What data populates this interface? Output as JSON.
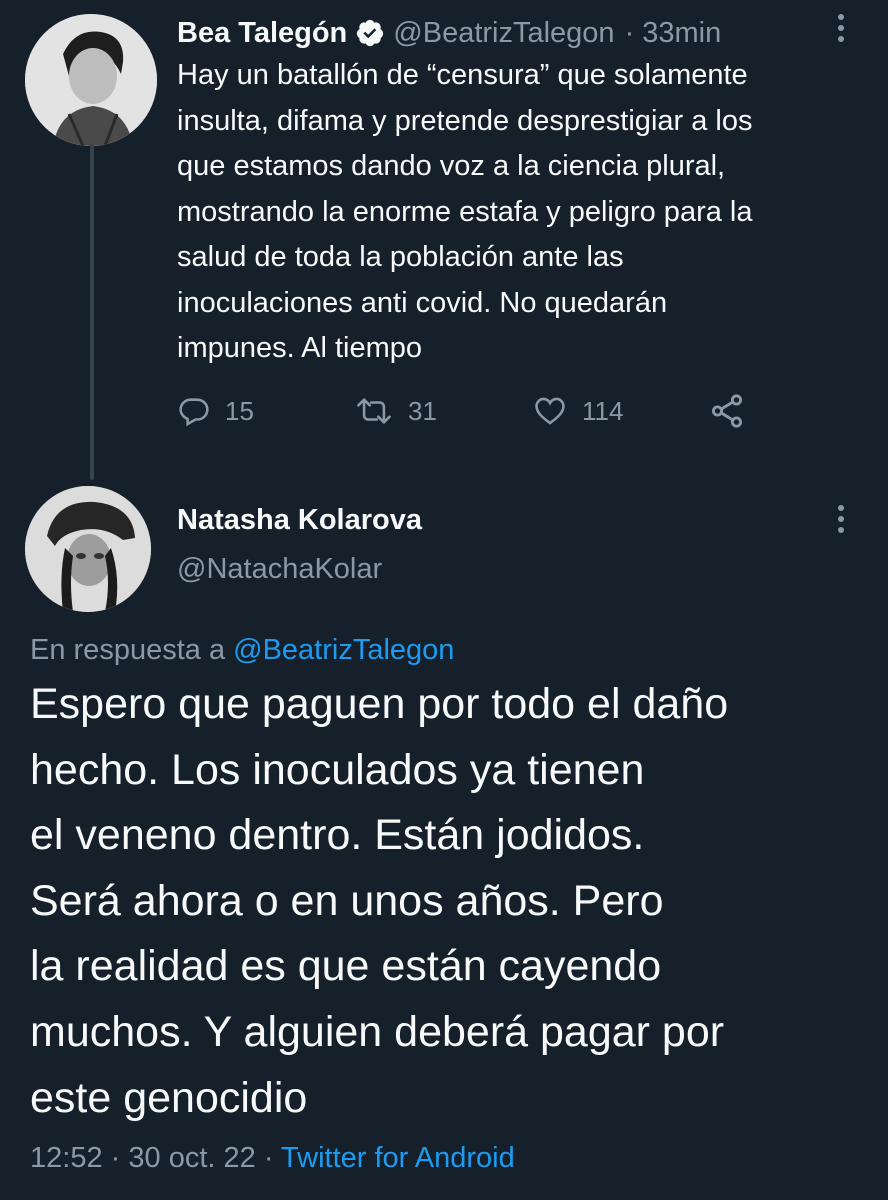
{
  "tweet1": {
    "name": "Bea Talegón",
    "handle": "@BeatrizTalegon",
    "separator": "·",
    "time": "33min",
    "lines": [
      "Hay un batallón de “censura” que solamente",
      "insulta, difama y pretende desprestigiar a los",
      "que estamos dando voz a la ciencia plural,",
      "mostrando la enorme estafa y peligro para la",
      "salud de toda la población ante las",
      "inoculaciones anti covid. No quedarán",
      "impunes. Al tiempo"
    ],
    "replies": "15",
    "retweets": "31",
    "likes": "114",
    "icons": {
      "verified": "verified-badge-icon",
      "reply": "reply-icon",
      "retweet": "retweet-icon",
      "like": "heart-icon",
      "share": "share-icon",
      "more": "more-icon"
    }
  },
  "tweet2": {
    "name": "Natasha Kolarova",
    "handle": "@NatachaKolar",
    "reply_prefix": "En respuesta a",
    "reply_to": "@BeatrizTalegon",
    "lines": [
      "Espero que paguen por todo el daño",
      "hecho. Los inoculados ya tienen",
      "el veneno dentro. Están jodidos.",
      "Será ahora o en unos años. Pero",
      "la realidad es que están cayendo",
      "muchos. Y alguien deberá pagar por",
      "este genocidio"
    ],
    "time": "12:52",
    "sep": "·",
    "date": "30 oct. 22",
    "source": "Twitter for Android"
  },
  "colors": {
    "background": "#15202b",
    "text": "#f7f9f9",
    "muted": "#8b98a5",
    "accent": "#1d9bf0"
  }
}
